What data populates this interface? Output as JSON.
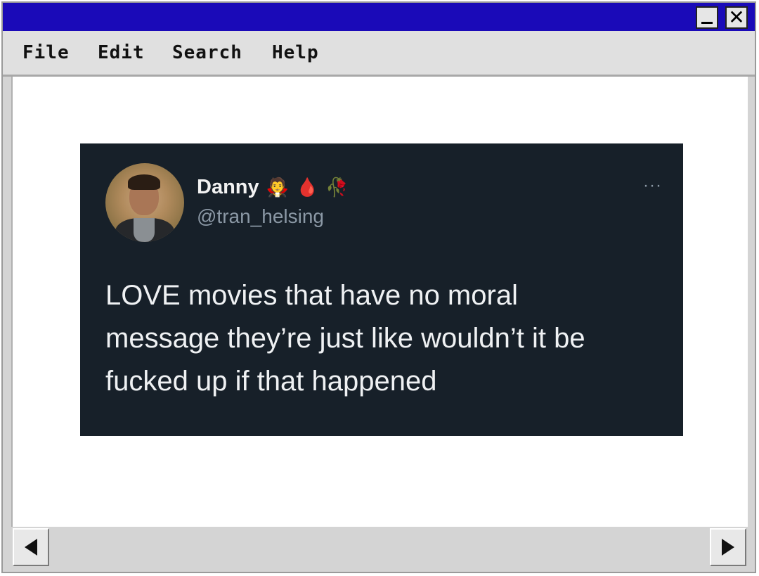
{
  "titlebar": {
    "minimize_icon": "minimize-icon",
    "close_icon": "close-icon",
    "close_glyph": "✕",
    "color": "#1a0ab8"
  },
  "menu": {
    "items": [
      {
        "label": "File"
      },
      {
        "label": "Edit"
      },
      {
        "label": "Search"
      },
      {
        "label": "Help"
      }
    ]
  },
  "tweet": {
    "background": "#172029",
    "display_name": "Danny",
    "emojis": [
      "🧛",
      "🩸",
      "🥀"
    ],
    "emoji_names": [
      "vampire-emoji",
      "drop-of-blood-emoji",
      "wilted-rose-emoji"
    ],
    "handle": "@tran_helsing",
    "more_glyph": "···",
    "text_lines": [
      "LOVE movies that have no moral",
      "message they’re just like wouldn’t it be",
      "fucked up if that happened"
    ]
  },
  "scrollbar": {
    "left_icon": "arrow-left-icon",
    "right_icon": "arrow-right-icon"
  }
}
